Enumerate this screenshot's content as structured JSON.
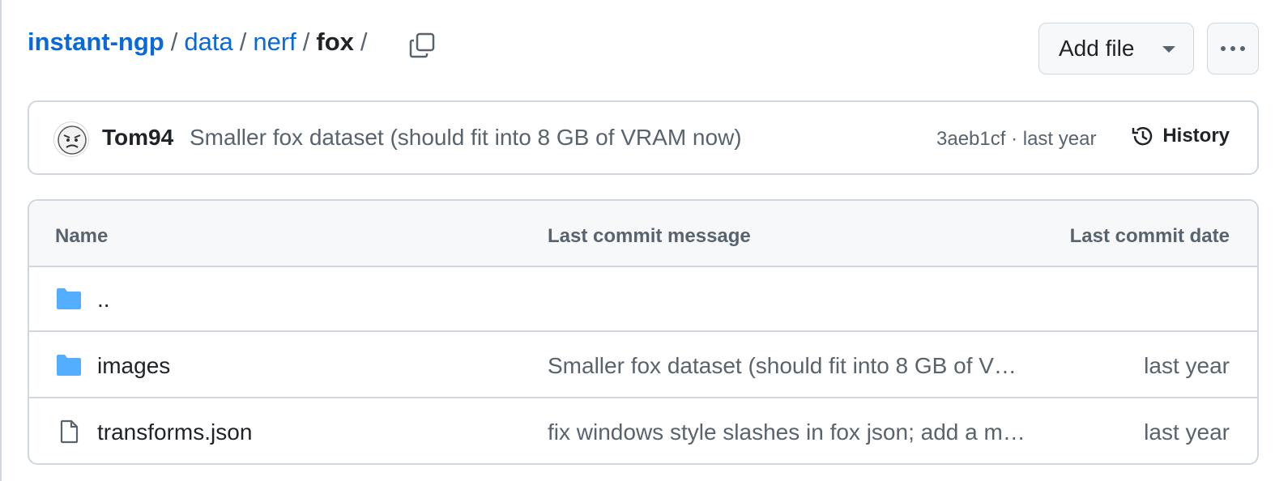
{
  "breadcrumb": {
    "root": "instant-ngp",
    "parts": [
      "data",
      "nerf"
    ],
    "current": "fox",
    "separator": "/"
  },
  "toolbar": {
    "add_file_label": "Add file",
    "more_label": "..."
  },
  "latest_commit": {
    "author": "Tom94",
    "message": "Smaller fox dataset (should fit into 8 GB of VRAM now)",
    "meta": "3aeb1cf · last year",
    "history_label": "History"
  },
  "table": {
    "headers": {
      "name": "Name",
      "message": "Last commit message",
      "date": "Last commit date"
    },
    "rows": [
      {
        "type": "folder-up",
        "name": "..",
        "message": "",
        "date": ""
      },
      {
        "type": "folder",
        "name": "images",
        "message": "Smaller fox dataset (should fit into 8 GB of V…",
        "date": "last year"
      },
      {
        "type": "file",
        "name": "transforms.json",
        "message": "fix windows style slashes in fox json; add a m…",
        "date": "last year"
      }
    ]
  },
  "colors": {
    "link": "#0969da",
    "muted": "#59636e",
    "border": "#d0d7de",
    "folder": "#54aeff"
  }
}
